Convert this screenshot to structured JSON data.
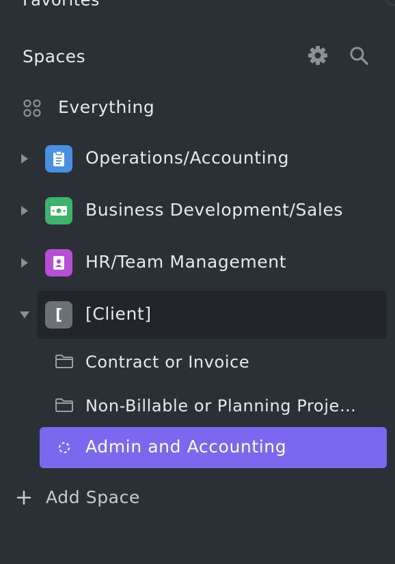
{
  "sidebar": {
    "favorites_label": "Favorites",
    "spaces": {
      "title": "Spaces",
      "settings_icon": "gear-icon",
      "search_icon": "search-icon"
    },
    "everything": {
      "label": "Everything",
      "icon": "grid-dots-icon"
    },
    "items": [
      {
        "label": "Operations/Accounting",
        "icon": "clipboard-icon",
        "color": "#4a90e2",
        "expanded": false
      },
      {
        "label": "Business Development/Sales",
        "icon": "money-icon",
        "color": "#3fb26b",
        "expanded": false
      },
      {
        "label": "HR/Team Management",
        "icon": "contact-book-icon",
        "color": "#b74fd4",
        "expanded": false
      },
      {
        "label": "[Client]",
        "avatar_text": "[",
        "color": "#6b7079",
        "expanded": true,
        "children": [
          {
            "label": "Contract or Invoice",
            "icon": "folder-icon"
          },
          {
            "label": "Non-Billable or Planning Proje…",
            "icon": "folder-icon"
          },
          {
            "label": "Admin and Accounting",
            "icon": "dashed-circle-icon",
            "active": true
          }
        ]
      }
    ],
    "add_space_label": "Add Space"
  },
  "colors": {
    "background": "#2b2f36",
    "selected_space_bg": "#22262c",
    "active_item_bg": "#7b68ee"
  }
}
